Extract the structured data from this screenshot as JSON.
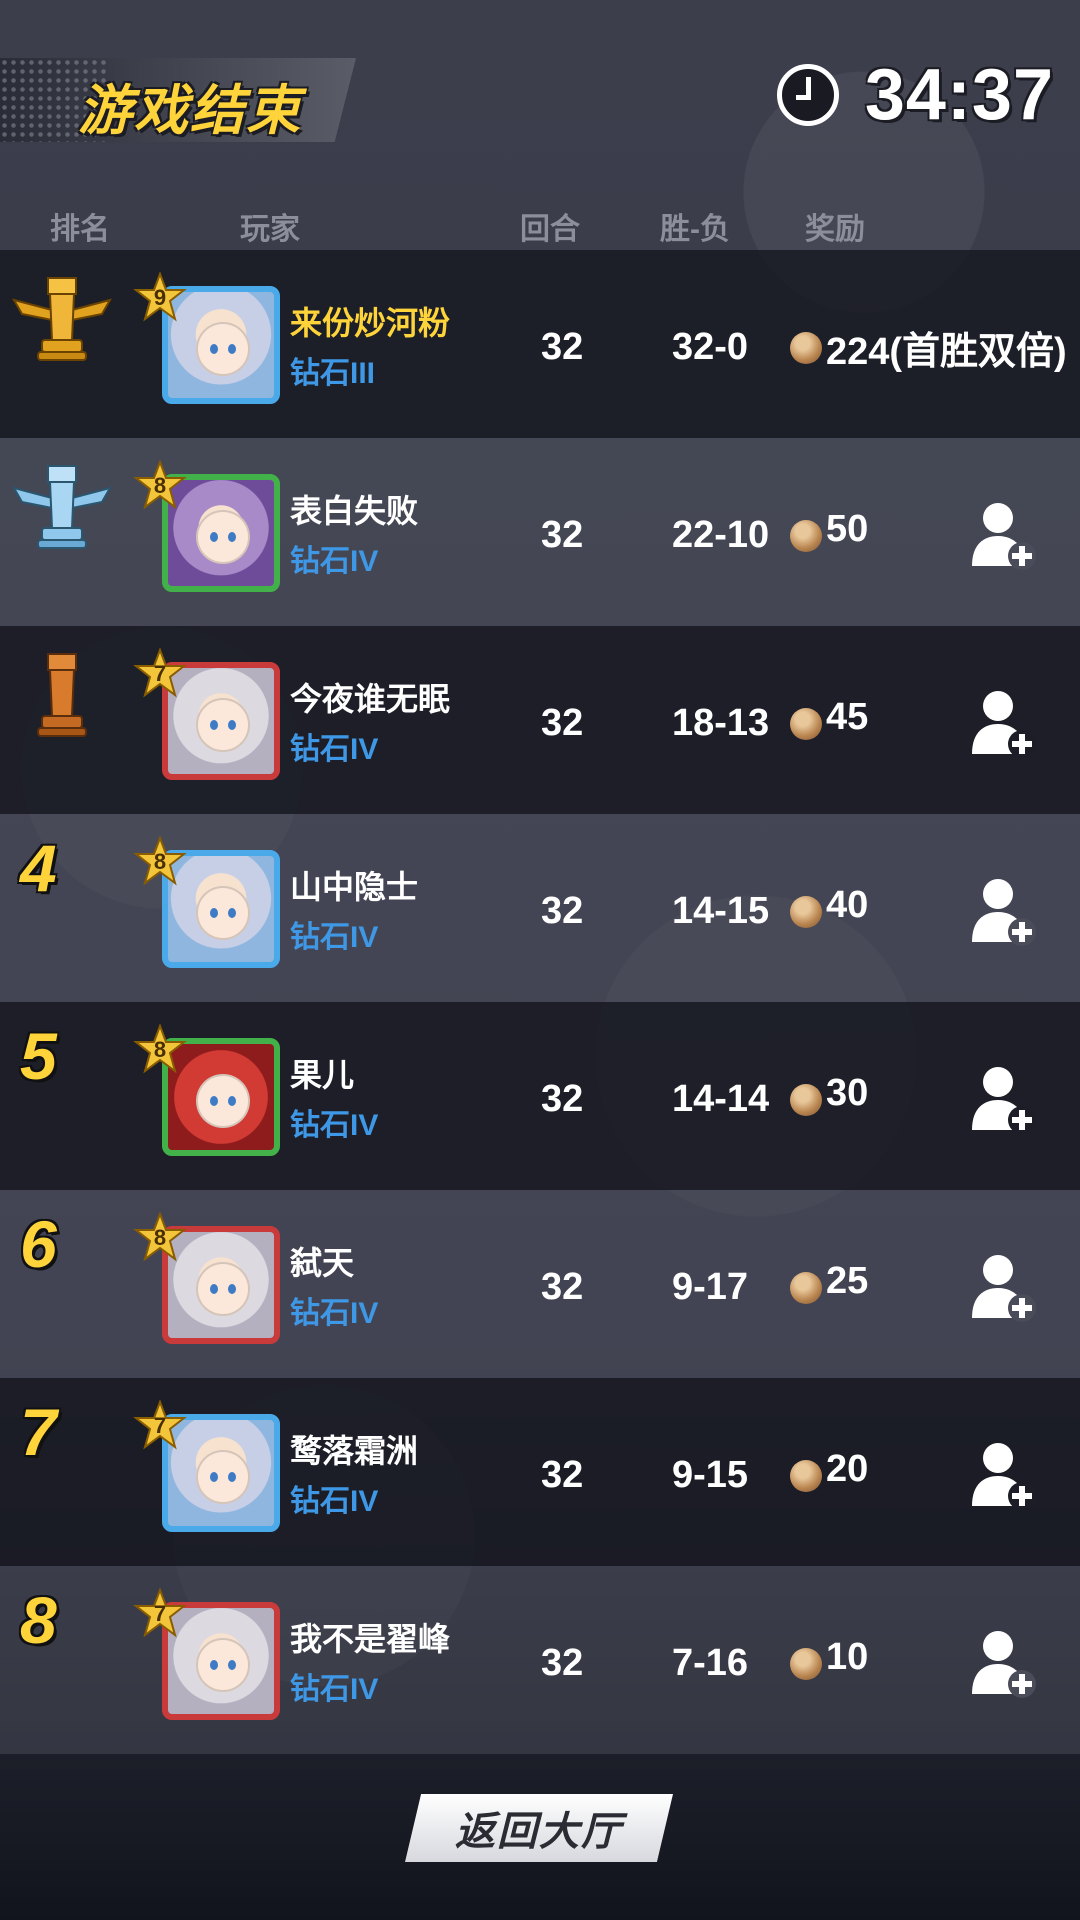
{
  "header": {
    "title": "游戏结束",
    "timer": "34:37",
    "icon": "clock-icon"
  },
  "columns": {
    "rank": "排名",
    "player": "玩家",
    "round": "回合",
    "win_loss": "胜-负",
    "reward": "奖励"
  },
  "players": [
    {
      "rank": "1",
      "rank_display": "gold-trophy",
      "level": "9",
      "name": "来份炒河粉",
      "tier": "钻石III",
      "round": "32",
      "win_loss": "32-0",
      "reward": "224(首胜双倍)",
      "self": true
    },
    {
      "rank": "2",
      "rank_display": "silver-trophy",
      "level": "8",
      "name": "表白失败",
      "tier": "钻石IV",
      "round": "32",
      "win_loss": "22-10",
      "reward": "50"
    },
    {
      "rank": "3",
      "rank_display": "bronze-trophy",
      "level": "7",
      "name": "今夜谁无眠",
      "tier": "钻石IV",
      "round": "32",
      "win_loss": "18-13",
      "reward": "45"
    },
    {
      "rank": "4",
      "level": "8",
      "name": "山中隐士",
      "tier": "钻石IV",
      "round": "32",
      "win_loss": "14-15",
      "reward": "40"
    },
    {
      "rank": "5",
      "level": "8",
      "name": "果儿",
      "tier": "钻石IV",
      "round": "32",
      "win_loss": "14-14",
      "reward": "30"
    },
    {
      "rank": "6",
      "level": "8",
      "name": "弑天",
      "tier": "钻石IV",
      "round": "32",
      "win_loss": "9-17",
      "reward": "25"
    },
    {
      "rank": "7",
      "level": "7",
      "name": "鹜落霜洲",
      "tier": "钻石IV",
      "round": "32",
      "win_loss": "9-15",
      "reward": "20"
    },
    {
      "rank": "8",
      "level": "7",
      "name": "我不是翟峰",
      "tier": "钻石IV",
      "round": "32",
      "win_loss": "7-16",
      "reward": "10"
    }
  ],
  "back_button": "返回大厅",
  "colors": {
    "accent_gold": "#ffd43a",
    "tier_blue": "#3f98e6"
  }
}
